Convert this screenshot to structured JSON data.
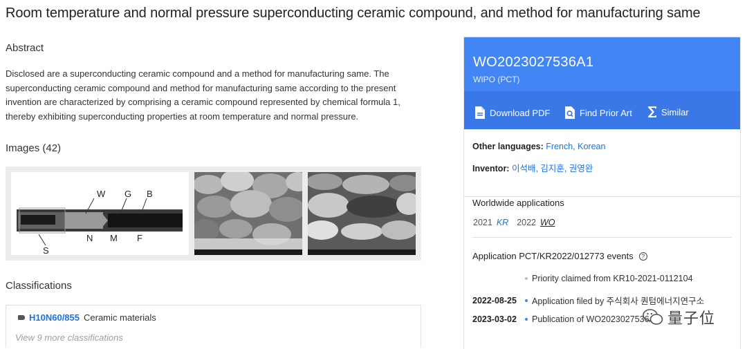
{
  "page": {
    "title": "Room temperature and normal pressure superconducting ceramic compound, and method for manufacturing same"
  },
  "abstract": {
    "heading": "Abstract",
    "text": "Disclosed are a superconducting ceramic compound and a method for manufacturing same. The superconducting ceramic compound and method for manufacturing same according to the present invention are characterized by comprising a ceramic compound represented by chemical formula 1, thereby exhibiting superconducting properties at room temperature and normal pressure."
  },
  "images": {
    "heading": "Images (42)",
    "figure_labels": [
      "W",
      "G",
      "B",
      "N",
      "M",
      "F",
      "S"
    ]
  },
  "classifications": {
    "heading": "Classifications",
    "code": "H10N60/855",
    "description": "Ceramic materials",
    "more": "View 9 more classifications"
  },
  "panel": {
    "pub_number": "WO2023027536A1",
    "office": "WIPO (PCT)",
    "actions": {
      "download": "Download PDF",
      "prior_art": "Find Prior Art",
      "similar": "Similar"
    },
    "other_languages_label": "Other languages:",
    "other_languages": "French, Korean",
    "inventor_label": "Inventor:",
    "inventors": "이석배, 김지훈, 권영완",
    "worldwide": {
      "title": "Worldwide applications",
      "year1": "2021",
      "cc1": "KR",
      "year2": "2022",
      "cc2": "WO"
    },
    "events": {
      "title": "Application PCT/KR2022/012773 events",
      "items": [
        {
          "date": "",
          "text": "Priority claimed from KR10-2021-0112104"
        },
        {
          "date": "2022-08-25",
          "text": "Application filed by 주식회사 퀀텀에너지연구소"
        },
        {
          "date": "2023-03-02",
          "text": "Publication of WO2023027536A1"
        }
      ]
    }
  },
  "watermark": {
    "text": "量子位"
  },
  "colors": {
    "accent": "#4285f4",
    "link": "#1a73e8"
  }
}
